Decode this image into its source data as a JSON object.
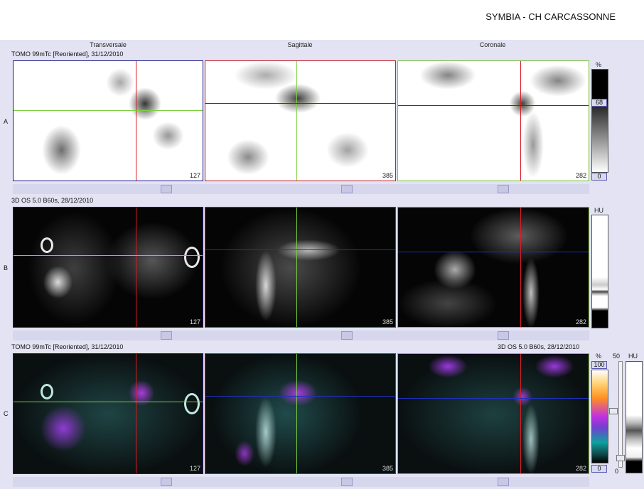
{
  "header": {
    "hospital": "SYMBIA - CH CARCASSONNE"
  },
  "columns": {
    "transverse": "Transversale",
    "sagittal": "Sagittale",
    "coronal": "Coronale"
  },
  "rows": {
    "a": {
      "letter": "A",
      "series": "TOMO 99mTc [Reoriented], 31/12/2010"
    },
    "b": {
      "letter": "B",
      "series": "3D  OS  5.0  B60s, 28/12/2010"
    },
    "c": {
      "letter": "C",
      "series_left": "TOMO 99mTc [Reoriented], 31/12/2010",
      "series_right": "3D  OS  5.0  B60s, 28/12/2010"
    }
  },
  "slices": {
    "transverse": "127",
    "sagittal": "385",
    "coronal": "282"
  },
  "scales": {
    "a": {
      "unit": "%",
      "top": "68",
      "bottom": "0"
    },
    "b": {
      "unit": "HU"
    },
    "c": {
      "unit_left": "%",
      "top": "100",
      "bottom": "0",
      "level_top": "50",
      "level_bottom": "0",
      "unit_right": "HU"
    }
  },
  "colors": {
    "crosshair_red": "#d81c24",
    "crosshair_green": "#7cd040",
    "crosshair_blue": "#2030c0",
    "background": "#e3e3f3"
  }
}
